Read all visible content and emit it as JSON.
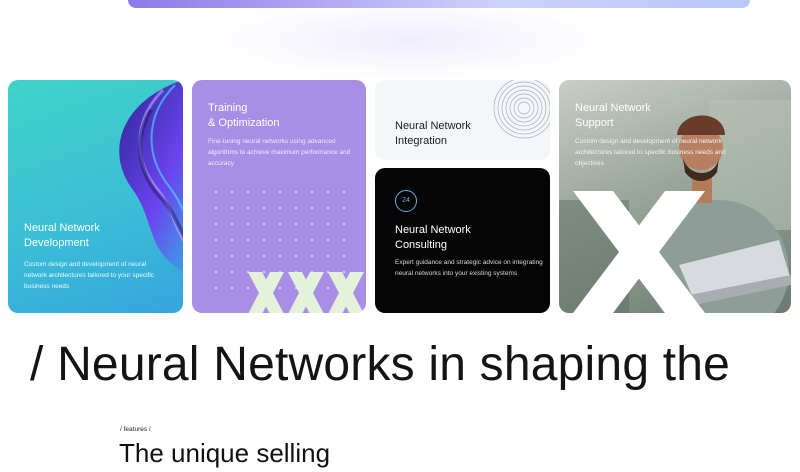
{
  "cards": [
    {
      "title": "Neural Network\nDevelopment",
      "description": "Custom design and development of neural network architectures tailored to your specific business needs",
      "color": "#3fc6d1"
    },
    {
      "title": "Training\n& Optimization",
      "description": "Fine-tuning neural networks using advanced algorithms to achieve maximum performance and accuracy",
      "color": "#a98ee6"
    },
    {
      "title": "Neural Network\nIntegration",
      "color": "#f4f6f9"
    },
    {
      "title": "Neural Network\nConsulting",
      "badge": "24",
      "description": "Expert guidance and strategic advice on integrating neural networks into your existing systems",
      "color": "#050506"
    },
    {
      "title": "Neural Network\nSupport",
      "description": "Custom design and development of neural network architectures tailored to specific business needs and objectives",
      "color": "#9aa69b"
    }
  ],
  "headline": "/ Neural Networks in shaping the",
  "features": {
    "eyebrow": "/ features /",
    "title": "The unique selling"
  }
}
